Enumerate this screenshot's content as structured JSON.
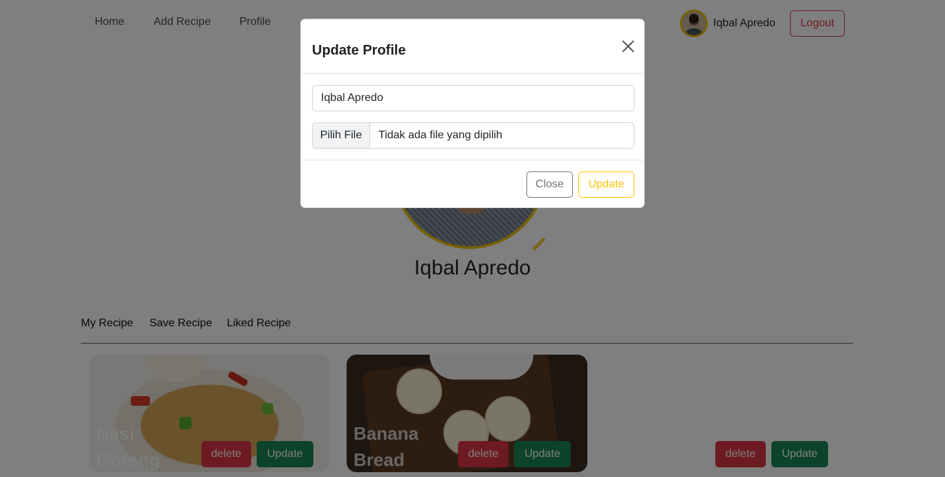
{
  "navbar": {
    "links": [
      "Home",
      "Add Recipe",
      "Profile"
    ],
    "username": "Iqbal Apredo",
    "logout_label": "Logout"
  },
  "profile": {
    "name": "Iqbal Apredo"
  },
  "tabs": [
    "My Recipe",
    "Save Recipe",
    "Liked Recipe"
  ],
  "recipes": [
    {
      "title_line1": "Nasi",
      "title_line2": "Goreng",
      "delete_label": "delete",
      "update_label": "Update"
    },
    {
      "title_line1": "Banana",
      "title_line2": "Bread",
      "delete_label": "delete",
      "update_label": "Update"
    },
    {
      "title_line1": "",
      "title_line2": "",
      "delete_label": "delete",
      "update_label": "Update"
    }
  ],
  "modal": {
    "title": "Update Profile",
    "name_value": "Iqbal Apredo",
    "file_button_label": "Pilih File",
    "file_status": "Tidak ada file yang dipilih",
    "close_label": "Close",
    "update_label": "Update"
  },
  "colors": {
    "accent_yellow": "#ffc107",
    "danger": "#dc3545",
    "success": "#198754"
  }
}
